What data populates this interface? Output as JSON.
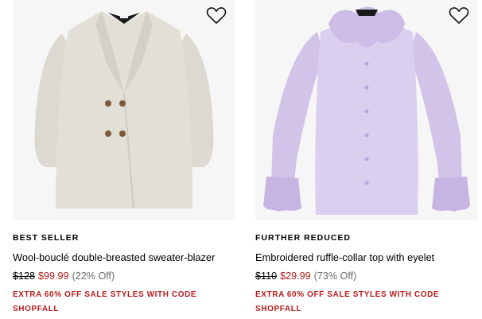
{
  "products": [
    {
      "badge": "BEST SELLER",
      "title": "Wool-bouclé double-breasted sweater-blazer",
      "original_price": "$128",
      "sale_price": "$99.99",
      "discount": "(22% Off)",
      "promo": "EXTRA 60% OFF SALE STYLES WITH CODE SHOPFALL",
      "image_icon": "gray-blazer-image",
      "wishlist_icon": "heart-icon"
    },
    {
      "badge": "FURTHER REDUCED",
      "title": "Embroidered ruffle-collar top with eyelet",
      "original_price": "$110",
      "sale_price": "$29.99",
      "discount": "(73% Off)",
      "promo": "EXTRA 60% OFF SALE STYLES WITH CODE SHOPFALL",
      "image_icon": "lavender-ruffle-top-image",
      "wishlist_icon": "heart-icon"
    }
  ],
  "colors": {
    "sale_red": "#b81b1b",
    "image_bg": "#f6f6f6",
    "discount_gray": "#6b6b6b"
  }
}
